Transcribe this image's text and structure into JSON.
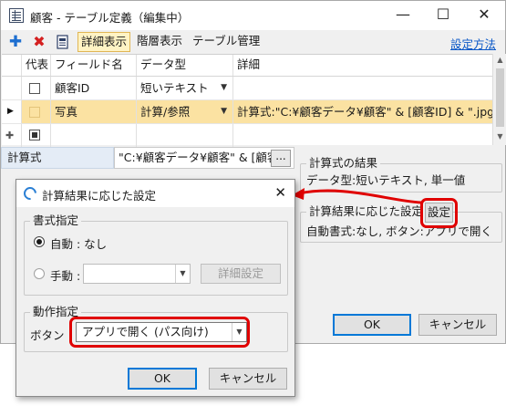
{
  "window": {
    "title": "顧客 - テーブル定義（編集中）",
    "controls": [
      "—",
      "☐",
      "✕"
    ]
  },
  "toolbar": {
    "add_symbol": "✚",
    "delete_symbol": "✖",
    "tabs": [
      "詳細表示",
      "階層表示",
      "テーブル管理"
    ],
    "active_tab": "詳細表示",
    "help_link": "設定方法"
  },
  "grid": {
    "columns": [
      "代表",
      "フィールド名",
      "データ型",
      "詳細"
    ],
    "rows": [
      {
        "marker": "",
        "field": "顧客ID",
        "type": "短いテキスト",
        "detail": ""
      },
      {
        "marker": "▶",
        "field": "写真",
        "type": "計算/参照",
        "detail": "計算式:\"C:¥顧客データ¥顧客\" & [顧客ID] & \".jpg"
      },
      {
        "marker": "✚",
        "field": "",
        "type": "",
        "detail": ""
      }
    ],
    "dropdown_glyph": "▼"
  },
  "formula": {
    "label": "計算式",
    "value": "\"C:¥顧客データ¥顧客\" & [顧客ID",
    "ellipsis": "..."
  },
  "result_group": {
    "caption": "計算式の結果",
    "text": "データ型:短いテキスト, 単一値"
  },
  "settings_group": {
    "caption": "計算結果に応じた設定",
    "button": "設定",
    "text": "自動書式:なし, ボタン:アプリで開く"
  },
  "main_buttons": {
    "ok": "OK",
    "cancel": "キャンセル"
  },
  "dialog": {
    "title": "計算結果に応じた設定",
    "close": "✕",
    "format_group": {
      "caption": "書式指定",
      "auto_label": "自動 : なし",
      "manual_label": "手動 :",
      "manual_value": "",
      "detail_button": "詳細設定"
    },
    "action_group": {
      "caption": "動作指定",
      "button_label": "ボタン",
      "button_value": "アプリで開く (パス向け)"
    },
    "ok": "OK",
    "cancel": "キャンセル"
  },
  "colors": {
    "selected_row": "#fbe2a2",
    "active_tab_bg": "#fff3c4",
    "highlight_ring": "#e00000",
    "link": "#0b58c7"
  }
}
